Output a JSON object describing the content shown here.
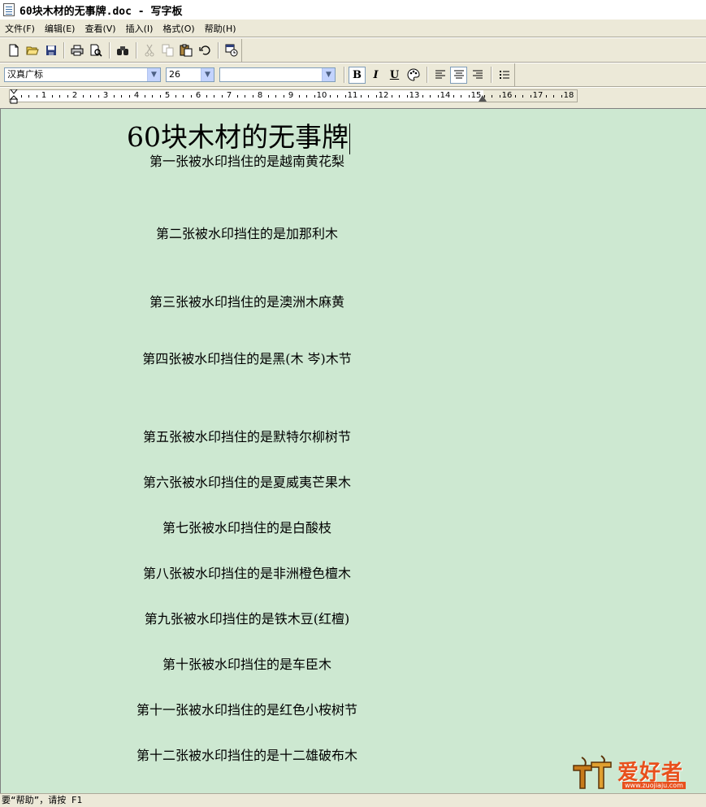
{
  "window": {
    "title": "60块木材的无事牌.doc - 写字板"
  },
  "menu": {
    "items": [
      "文件(F)",
      "编辑(E)",
      "查看(V)",
      "插入(I)",
      "格式(O)",
      "帮助(H)"
    ]
  },
  "toolbar": {
    "buttons": [
      "new-icon",
      "open-icon",
      "save-icon",
      "print-icon",
      "print-preview-icon",
      "find-icon",
      "cut-icon",
      "copy-icon",
      "paste-icon",
      "undo-icon",
      "date-time-icon"
    ]
  },
  "format": {
    "font": "汉真广标",
    "size": "26",
    "script": "",
    "bold": "B",
    "italic": "I",
    "underline": "U",
    "align_center_active": true
  },
  "ruler": {
    "numbers": [
      "1",
      "2",
      "3",
      "4",
      "5",
      "6",
      "7",
      "8",
      "9",
      "10",
      "11",
      "12",
      "13",
      "14",
      "15",
      "16",
      "17",
      "18"
    ]
  },
  "document": {
    "heading": "60块木材的无事牌",
    "lines": [
      "第一张被水印挡住的是越南黄花梨",
      "第二张被水印挡住的是加那利木",
      "第三张被水印挡住的是澳洲木麻黄",
      "第四张被水印挡住的是黑(木 岑)木节",
      "第五张被水印挡住的是默特尔柳树节",
      "第六张被水印挡住的是夏威夷芒果木",
      "第七张被水印挡住的是白酸枝",
      "第八张被水印挡住的是非洲橙色檀木",
      "第九张被水印挡住的是铁木豆(红檀)",
      "第十张被水印挡住的是车臣木",
      "第十一张被水印挡住的是红色小桉树节",
      "第十二张被水印挡住的是十二雄破布木"
    ]
  },
  "status": {
    "text": "要“帮助”，请按 F1"
  },
  "watermark": {
    "text": "爱好者",
    "url": "www.zuojiaju.com"
  },
  "colors": {
    "document_bg": "#cde8d1",
    "chrome_bg": "#ece9d8",
    "watermark_orange": "#e8501c"
  }
}
